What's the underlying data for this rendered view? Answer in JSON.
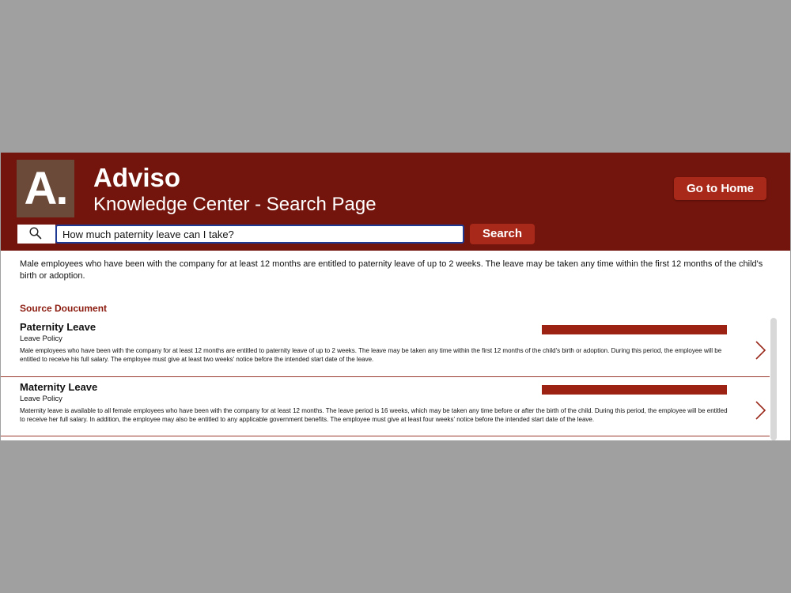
{
  "header": {
    "logo_text": "A.",
    "title": "Adviso",
    "subtitle": "Knowledge Center - Search Page",
    "home_button": "Go to Home"
  },
  "search": {
    "query": "How much paternity leave can I take?",
    "button_label": "Search"
  },
  "answer": {
    "text": " Male employees who have been with the company for at least 12 months are entitled to paternity leave of up to 2 weeks. The leave may be taken any time within the first 12 months of the child's birth or adoption."
  },
  "sources": {
    "heading": "Source Doucument",
    "items": [
      {
        "title": "Paternity Leave",
        "type": "Leave Policy",
        "body": "Male employees who have been with the company for at least 12 months are entitled to paternity leave of up to 2 weeks. The leave may be taken any time within the first 12 months of the child's birth or adoption. During this period, the employee will be entitled to receive his full salary. The employee must give at least two weeks' notice before the intended start date of the leave."
      },
      {
        "title": "Maternity Leave",
        "type": "Leave Policy",
        "body": "Maternity leave is available to all female employees who have been with the company for at least 12 months. The leave period is 16 weeks, which may be taken any time before or after the birth of the child. During this period, the employee will be entitled to receive her full salary. In addition, the employee may also be entitled to any applicable government benefits. The employee must give at least four weeks' notice before the intended start date of the leave."
      }
    ]
  },
  "colors": {
    "header_bg": "#73150c",
    "accent": "#a8291a",
    "logo_bg": "#6b4a3a",
    "heading_red": "#8b1a0e"
  }
}
